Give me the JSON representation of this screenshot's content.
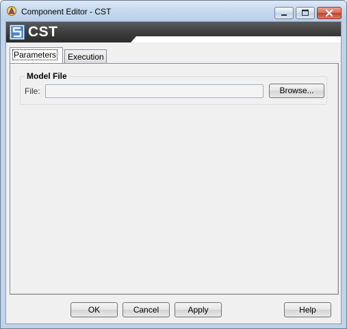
{
  "window": {
    "title": "Component Editor - CST",
    "icon": "app-icon",
    "controls": [
      "minimize-icon",
      "maximize-icon",
      "close-icon"
    ]
  },
  "banner": {
    "text": "CST",
    "logo": "cst-logo"
  },
  "tabs": [
    {
      "label": "Parameters",
      "active": true
    },
    {
      "label": "Execution",
      "active": false
    }
  ],
  "model_file": {
    "group_title": "Model File",
    "file_label": "File:",
    "file_value": "",
    "browse_label": "Browse..."
  },
  "footer": {
    "ok_label": "OK",
    "cancel_label": "Cancel",
    "apply_label": "Apply",
    "help_label": "Help"
  }
}
